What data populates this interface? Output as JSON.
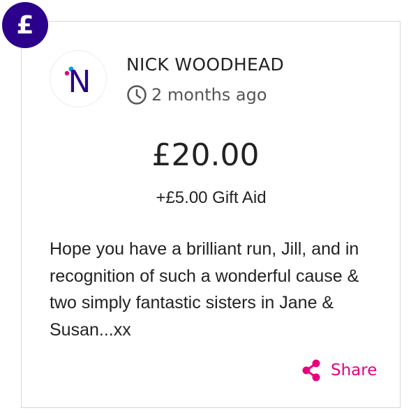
{
  "badge": {
    "symbol": "£",
    "color": "#2b008a"
  },
  "donation": {
    "avatar_letter": "N",
    "avatar_colors": [
      "#2b008a",
      "#e6007e",
      "#00a3e0"
    ],
    "donor_name": "NICK WOODHEAD",
    "time_ago": "2 months ago",
    "amount": "£20.00",
    "gift_aid": "+£5.00 Gift Aid",
    "message": "Hope you have a brilliant run, Jill, and in recognition of such a wonderful cause & two simply fantastic sisters in Jane & Susan...xx"
  },
  "actions": {
    "share_label": "Share",
    "share_color": "#e6007e"
  }
}
